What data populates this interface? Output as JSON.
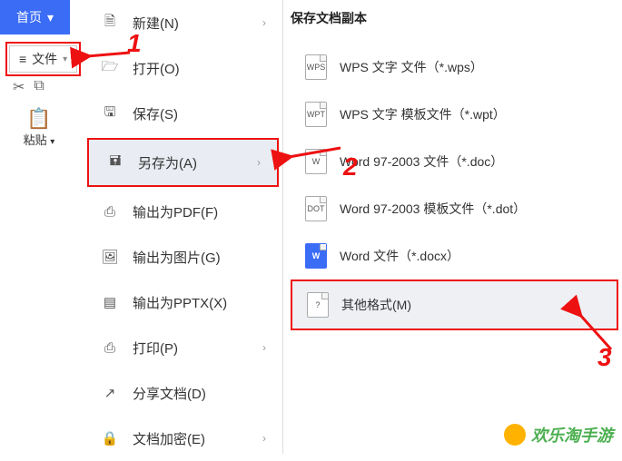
{
  "topbar": {
    "home_label": "首页",
    "file_label": "文件"
  },
  "toolbar": {
    "paste_label": "粘贴"
  },
  "menu": {
    "items": [
      {
        "label": "新建(N)"
      },
      {
        "label": "打开(O)"
      },
      {
        "label": "保存(S)"
      },
      {
        "label": "另存为(A)"
      },
      {
        "label": "输出为PDF(F)"
      },
      {
        "label": "输出为图片(G)"
      },
      {
        "label": "输出为PPTX(X)"
      },
      {
        "label": "打印(P)"
      },
      {
        "label": "分享文档(D)"
      },
      {
        "label": "文档加密(E)"
      }
    ]
  },
  "right": {
    "title": "保存文档副本",
    "formats": [
      {
        "badge": "WPS",
        "label": "WPS 文字 文件（*.wps）"
      },
      {
        "badge": "WPT",
        "label": "WPS 文字 模板文件（*.wpt）"
      },
      {
        "badge": "W",
        "label": "Word 97-2003 文件（*.doc）"
      },
      {
        "badge": "DOT",
        "label": "Word 97-2003 模板文件（*.dot）"
      },
      {
        "badge": "W",
        "label": "Word 文件（*.docx）",
        "blue": true
      },
      {
        "badge": "?",
        "label": "其他格式(M)"
      }
    ]
  },
  "annotations": {
    "a1": "1",
    "a2": "2",
    "a3": "3"
  },
  "watermark": {
    "text": "欢乐淘手游"
  }
}
